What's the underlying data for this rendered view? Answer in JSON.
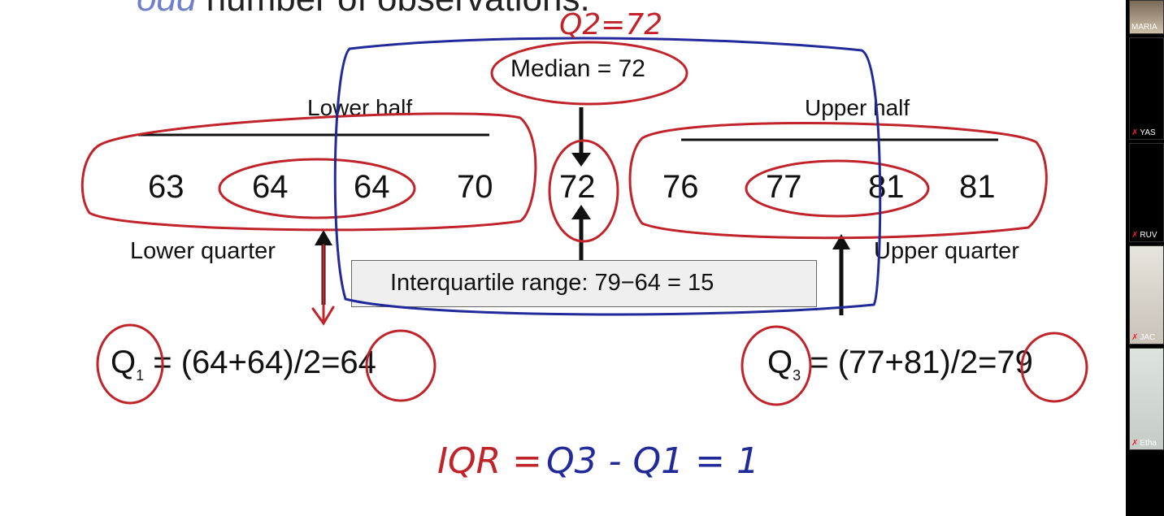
{
  "slide": {
    "title_italic": "odd",
    "title_rest": " number of observations.",
    "lower_half_label": "Lower half",
    "upper_half_label": "Upper half",
    "median_label": "Median = 72",
    "values": [
      "63",
      "64",
      "64",
      "70",
      "72",
      "76",
      "77",
      "81",
      "81"
    ],
    "lower_quarter_label": "Lower quarter",
    "upper_quarter_label": "Upper quarter",
    "iqr_label": "Interquartile range: 79−64 = 15",
    "q1": {
      "symbol": "Q",
      "sub": "1",
      "formula": " = (64+64)/2=64"
    },
    "q3": {
      "symbol": "Q",
      "sub": "3",
      "formula": " = (77+81)/2=79"
    }
  },
  "annotations": {
    "q2": "Q2=72",
    "iqr_red": "IQR =",
    "iqr_blue": "Q3 - Q1 = 1"
  },
  "participants": [
    {
      "name": "MARIA",
      "muted": false
    },
    {
      "name": "YAS",
      "muted": true
    },
    {
      "name": "RUV",
      "muted": true
    },
    {
      "name": "JAC",
      "muted": true
    },
    {
      "name": "Etha",
      "muted": true
    }
  ],
  "colors": {
    "ink_red": "#c0242a",
    "ink_blue": "#222a9a",
    "slide_bg": "#ffffff"
  }
}
